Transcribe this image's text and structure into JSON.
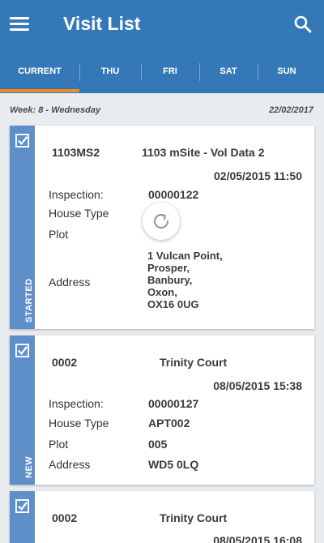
{
  "app": {
    "title": "Visit List"
  },
  "tabs": [
    {
      "label": "CURRENT"
    },
    {
      "label": "THU"
    },
    {
      "label": "FRI"
    },
    {
      "label": "SAT"
    },
    {
      "label": "SUN"
    }
  ],
  "week": {
    "label": "Week: 8 - Wednesday",
    "date": "22/02/2017"
  },
  "field_labels": {
    "inspection": "Inspection:",
    "house_type": "House Type",
    "plot": "Plot",
    "address": "Address"
  },
  "visits": [
    {
      "status": "STARTED",
      "code": "1103MS2",
      "site": "1103 mSite - Vol Data 2",
      "datetime": "02/05/2015 11:50",
      "inspection": "00000122",
      "house_type": "",
      "plot": "",
      "address": [
        "1 Vulcan Point,",
        "Prosper,",
        "Banbury,",
        "Oxon,",
        "OX16 0UG"
      ]
    },
    {
      "status": "NEW",
      "code": "0002",
      "site": "Trinity Court",
      "datetime": "08/05/2015 15:38",
      "inspection": "00000127",
      "house_type": "APT002",
      "plot": "005",
      "address": [
        "WD5 0LQ"
      ]
    },
    {
      "status": "",
      "code": "0002",
      "site": "Trinity Court",
      "datetime": "08/05/2015 16:08"
    }
  ],
  "colors": {
    "primary": "#3478b7",
    "strip": "#5e8fc9",
    "accent": "#f08a24",
    "background": "#e9ecef"
  },
  "icons": {
    "menu": "menu-icon",
    "search": "search-icon",
    "check": "checkbox-checked-icon",
    "spinner": "refresh-spinner-icon"
  }
}
